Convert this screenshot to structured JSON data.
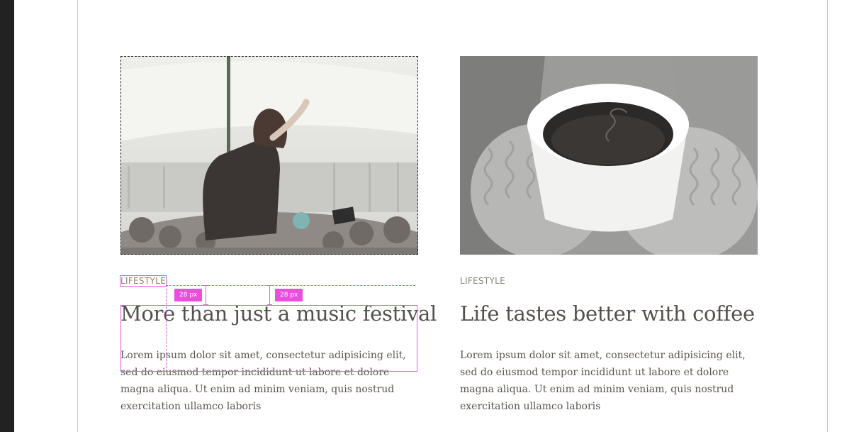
{
  "cards": [
    {
      "category": "LIFESTYLE",
      "title": "More than just a music festival",
      "body": "Lorem ipsum dolor sit amet, consectetur adipisicing elit, sed do eiusmod tempor incididunt ut labore et dolore magna aliqua. Ut enim ad minim veniam, quis nostrud exercitation ullamco laboris",
      "image": "concert-crowd-photo"
    },
    {
      "category": "LIFESTYLE",
      "title": "Life tastes better with coffee",
      "body": "Lorem ipsum dolor sit amet, consectetur adipisicing elit, sed do eiusmod tempor incididunt ut labore et dolore magna aliqua. Ut enim ad minim veniam, quis nostrud exercitation ullamco laboris",
      "image": "coffee-cup-photo"
    }
  ],
  "inspector": {
    "spacing_label_1": "28 px",
    "spacing_label_2": "28 px",
    "accent": "#e94fdc",
    "guide_color": "#7fe3ee"
  }
}
